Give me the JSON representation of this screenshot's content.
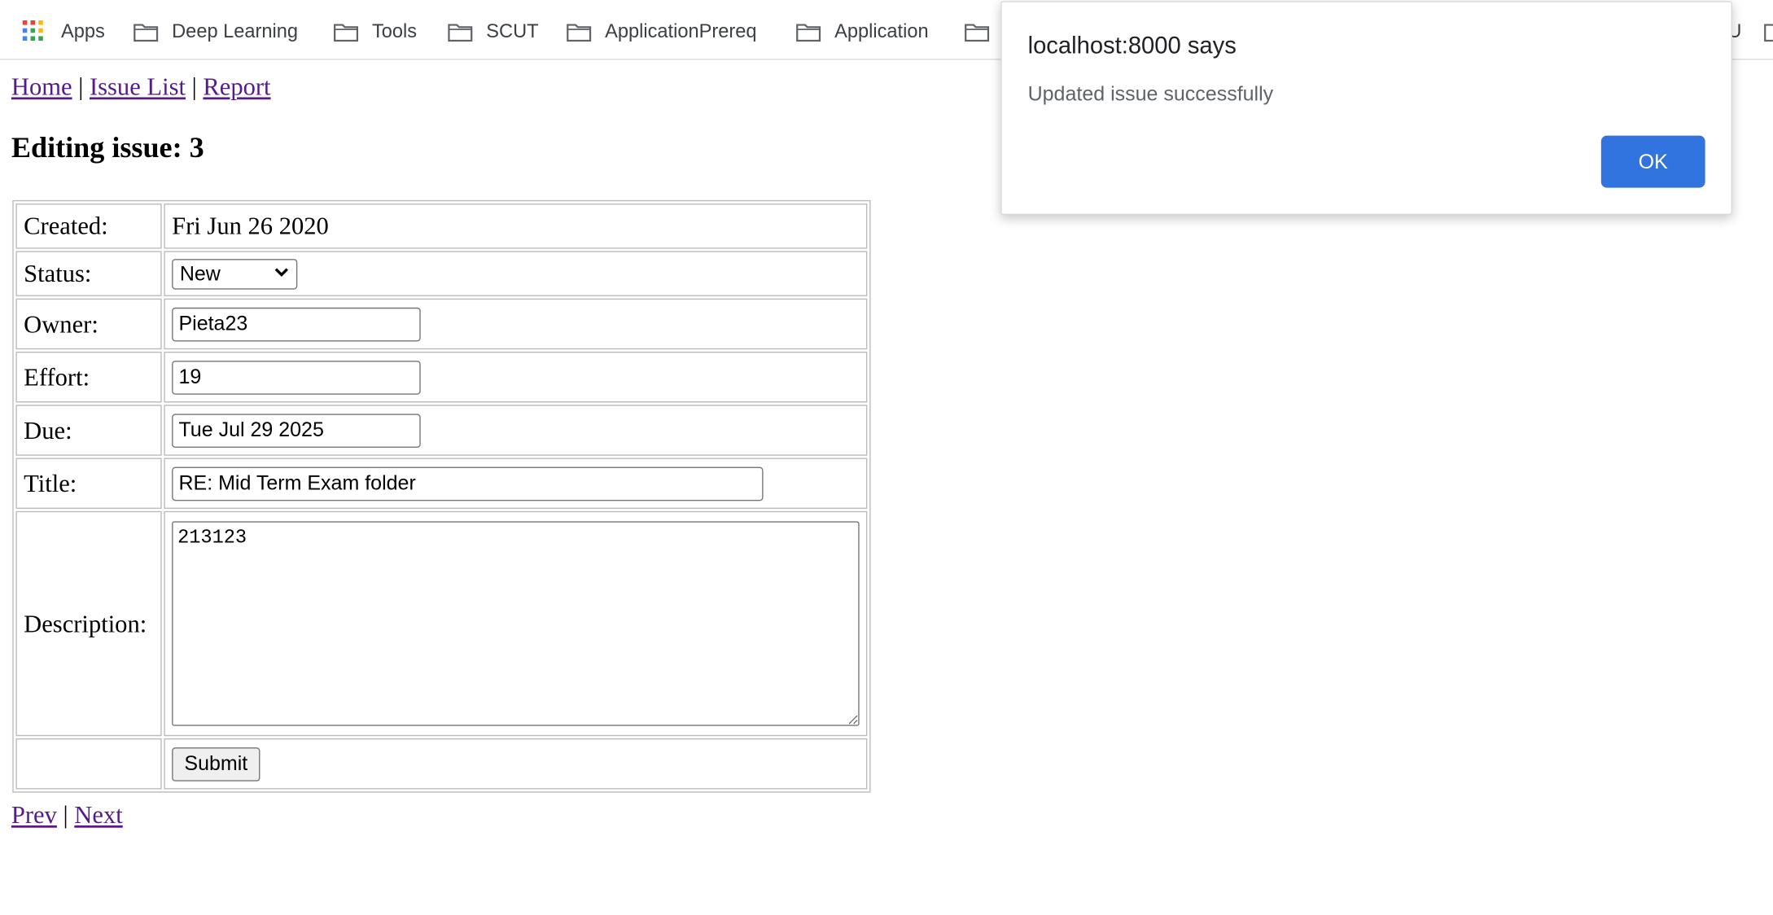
{
  "bookmarks": {
    "apps_label": "Apps",
    "items": [
      {
        "label": "Deep Learning"
      },
      {
        "label": "Tools"
      },
      {
        "label": "SCUT"
      },
      {
        "label": "ApplicationPrereq"
      },
      {
        "label": "Application"
      }
    ],
    "partial_right_label": "U"
  },
  "nav": {
    "home": "Home",
    "sep": "|",
    "issue_list": "Issue List",
    "report": "Report"
  },
  "heading": "Editing issue: 3",
  "form": {
    "created_label": "Created:",
    "created_value": "Fri Jun 26 2020",
    "status_label": "Status:",
    "status_value": "New",
    "owner_label": "Owner:",
    "owner_value": "Pieta23",
    "effort_label": "Effort:",
    "effort_value": "19",
    "due_label": "Due:",
    "due_value": "Tue Jul 29 2025",
    "title_label": "Title:",
    "title_value": "RE: Mid Term Exam folder",
    "description_label": "Description:",
    "description_value": "213123",
    "submit_label": "Submit"
  },
  "pager": {
    "prev": "Prev",
    "sep": "|",
    "next": "Next"
  },
  "dialog": {
    "title": "localhost:8000 says",
    "message": "Updated issue successfully",
    "ok_label": "OK"
  },
  "colors": {
    "link": "#551a8b",
    "dialog_button": "#3174e0",
    "folder_icon": "#9aa0a6"
  }
}
